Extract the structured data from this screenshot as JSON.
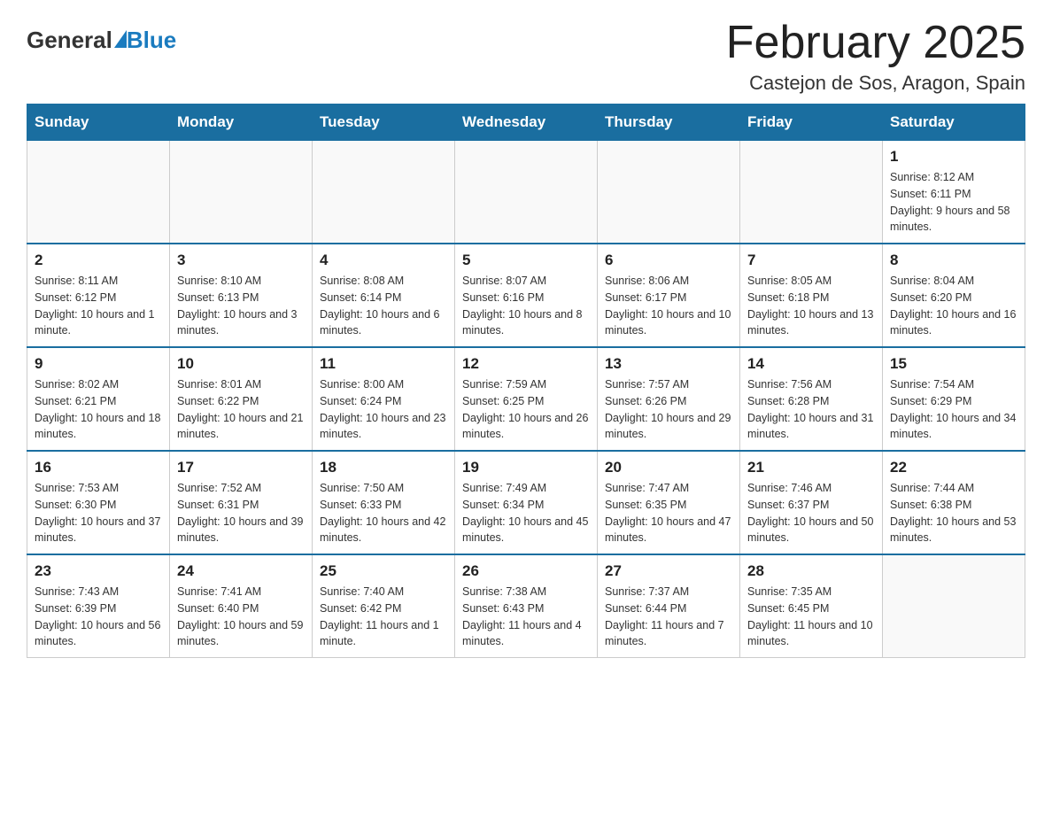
{
  "header": {
    "logo_general": "General",
    "logo_blue": "Blue",
    "title": "February 2025",
    "subtitle": "Castejon de Sos, Aragon, Spain"
  },
  "weekdays": [
    "Sunday",
    "Monday",
    "Tuesday",
    "Wednesday",
    "Thursday",
    "Friday",
    "Saturday"
  ],
  "weeks": [
    [
      {
        "day": "",
        "info": ""
      },
      {
        "day": "",
        "info": ""
      },
      {
        "day": "",
        "info": ""
      },
      {
        "day": "",
        "info": ""
      },
      {
        "day": "",
        "info": ""
      },
      {
        "day": "",
        "info": ""
      },
      {
        "day": "1",
        "info": "Sunrise: 8:12 AM\nSunset: 6:11 PM\nDaylight: 9 hours and 58 minutes."
      }
    ],
    [
      {
        "day": "2",
        "info": "Sunrise: 8:11 AM\nSunset: 6:12 PM\nDaylight: 10 hours and 1 minute."
      },
      {
        "day": "3",
        "info": "Sunrise: 8:10 AM\nSunset: 6:13 PM\nDaylight: 10 hours and 3 minutes."
      },
      {
        "day": "4",
        "info": "Sunrise: 8:08 AM\nSunset: 6:14 PM\nDaylight: 10 hours and 6 minutes."
      },
      {
        "day": "5",
        "info": "Sunrise: 8:07 AM\nSunset: 6:16 PM\nDaylight: 10 hours and 8 minutes."
      },
      {
        "day": "6",
        "info": "Sunrise: 8:06 AM\nSunset: 6:17 PM\nDaylight: 10 hours and 10 minutes."
      },
      {
        "day": "7",
        "info": "Sunrise: 8:05 AM\nSunset: 6:18 PM\nDaylight: 10 hours and 13 minutes."
      },
      {
        "day": "8",
        "info": "Sunrise: 8:04 AM\nSunset: 6:20 PM\nDaylight: 10 hours and 16 minutes."
      }
    ],
    [
      {
        "day": "9",
        "info": "Sunrise: 8:02 AM\nSunset: 6:21 PM\nDaylight: 10 hours and 18 minutes."
      },
      {
        "day": "10",
        "info": "Sunrise: 8:01 AM\nSunset: 6:22 PM\nDaylight: 10 hours and 21 minutes."
      },
      {
        "day": "11",
        "info": "Sunrise: 8:00 AM\nSunset: 6:24 PM\nDaylight: 10 hours and 23 minutes."
      },
      {
        "day": "12",
        "info": "Sunrise: 7:59 AM\nSunset: 6:25 PM\nDaylight: 10 hours and 26 minutes."
      },
      {
        "day": "13",
        "info": "Sunrise: 7:57 AM\nSunset: 6:26 PM\nDaylight: 10 hours and 29 minutes."
      },
      {
        "day": "14",
        "info": "Sunrise: 7:56 AM\nSunset: 6:28 PM\nDaylight: 10 hours and 31 minutes."
      },
      {
        "day": "15",
        "info": "Sunrise: 7:54 AM\nSunset: 6:29 PM\nDaylight: 10 hours and 34 minutes."
      }
    ],
    [
      {
        "day": "16",
        "info": "Sunrise: 7:53 AM\nSunset: 6:30 PM\nDaylight: 10 hours and 37 minutes."
      },
      {
        "day": "17",
        "info": "Sunrise: 7:52 AM\nSunset: 6:31 PM\nDaylight: 10 hours and 39 minutes."
      },
      {
        "day": "18",
        "info": "Sunrise: 7:50 AM\nSunset: 6:33 PM\nDaylight: 10 hours and 42 minutes."
      },
      {
        "day": "19",
        "info": "Sunrise: 7:49 AM\nSunset: 6:34 PM\nDaylight: 10 hours and 45 minutes."
      },
      {
        "day": "20",
        "info": "Sunrise: 7:47 AM\nSunset: 6:35 PM\nDaylight: 10 hours and 47 minutes."
      },
      {
        "day": "21",
        "info": "Sunrise: 7:46 AM\nSunset: 6:37 PM\nDaylight: 10 hours and 50 minutes."
      },
      {
        "day": "22",
        "info": "Sunrise: 7:44 AM\nSunset: 6:38 PM\nDaylight: 10 hours and 53 minutes."
      }
    ],
    [
      {
        "day": "23",
        "info": "Sunrise: 7:43 AM\nSunset: 6:39 PM\nDaylight: 10 hours and 56 minutes."
      },
      {
        "day": "24",
        "info": "Sunrise: 7:41 AM\nSunset: 6:40 PM\nDaylight: 10 hours and 59 minutes."
      },
      {
        "day": "25",
        "info": "Sunrise: 7:40 AM\nSunset: 6:42 PM\nDaylight: 11 hours and 1 minute."
      },
      {
        "day": "26",
        "info": "Sunrise: 7:38 AM\nSunset: 6:43 PM\nDaylight: 11 hours and 4 minutes."
      },
      {
        "day": "27",
        "info": "Sunrise: 7:37 AM\nSunset: 6:44 PM\nDaylight: 11 hours and 7 minutes."
      },
      {
        "day": "28",
        "info": "Sunrise: 7:35 AM\nSunset: 6:45 PM\nDaylight: 11 hours and 10 minutes."
      },
      {
        "day": "",
        "info": ""
      }
    ]
  ]
}
